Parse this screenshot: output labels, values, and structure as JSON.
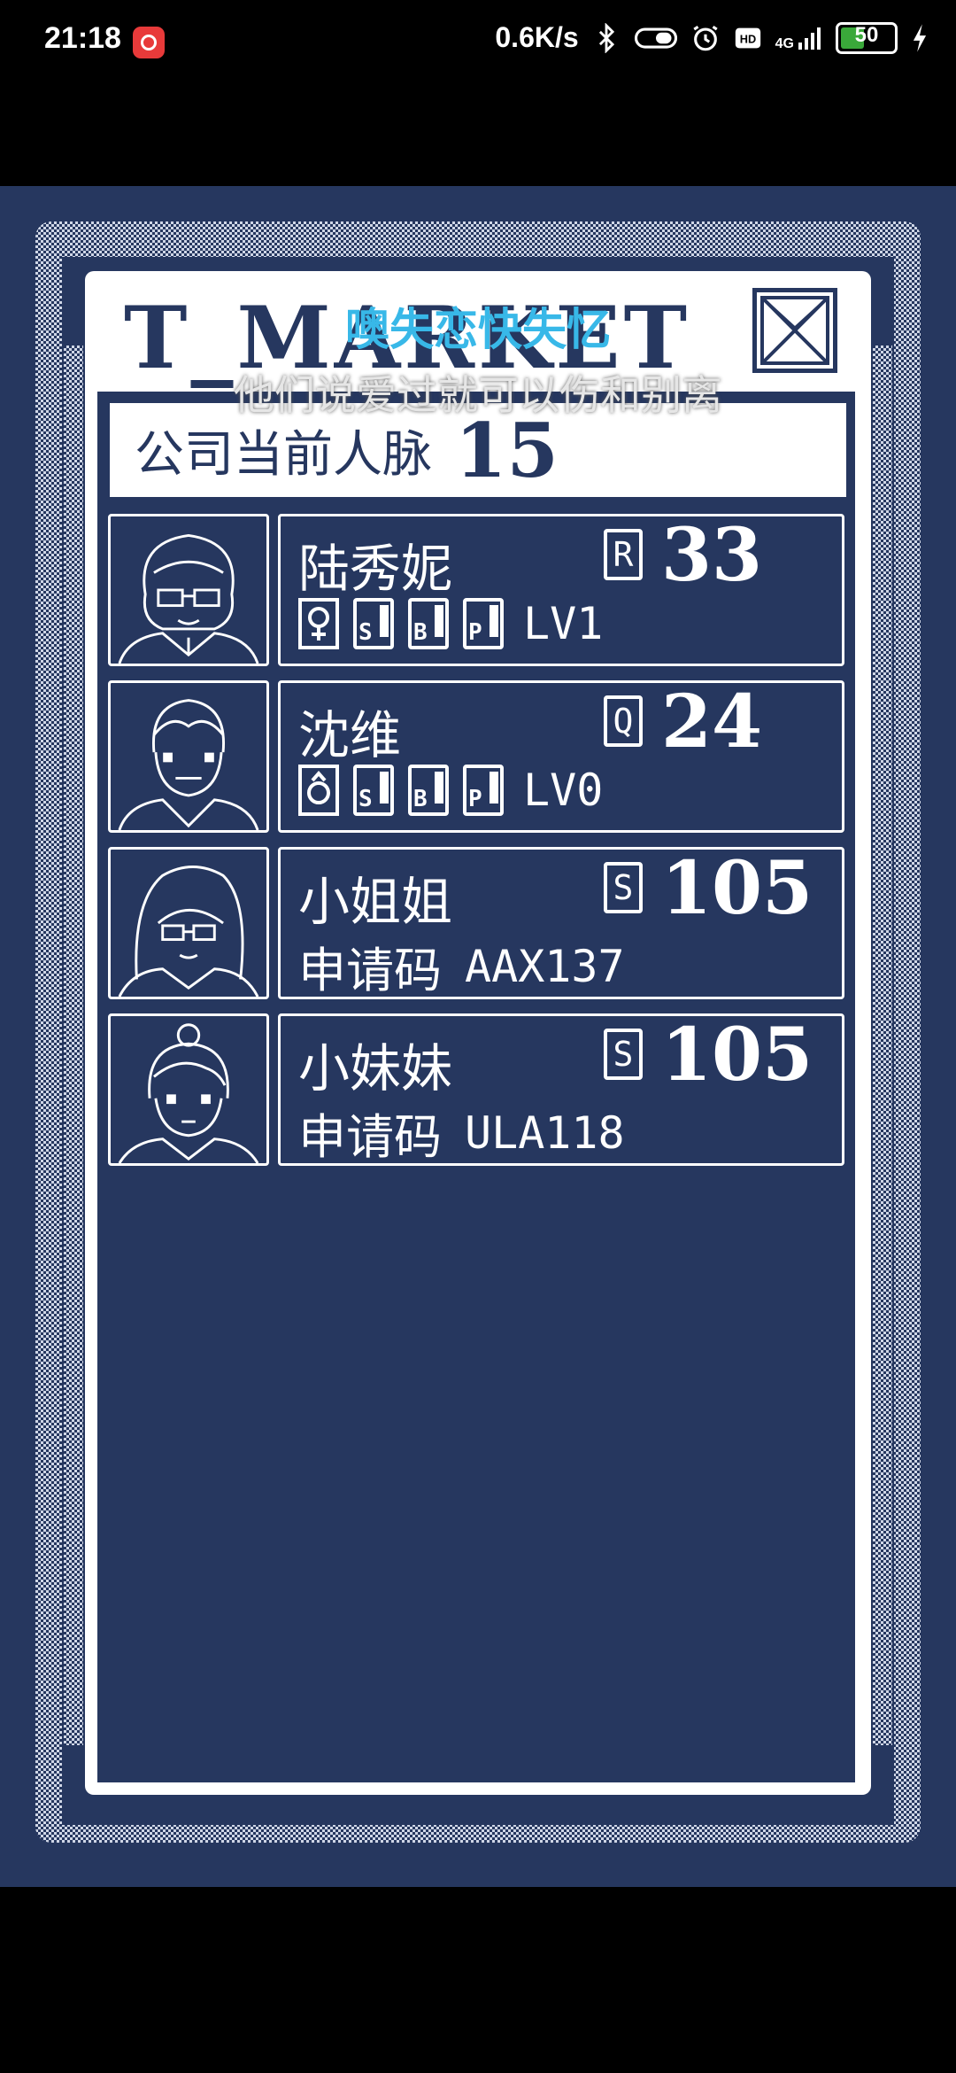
{
  "status_bar": {
    "time": "21:18",
    "net_speed": "0.6K/s",
    "signal_label": "4G",
    "battery": "50",
    "battery_level": 0.5
  },
  "game": {
    "title": "T_MARKET",
    "lyric_top": "噢失恋快失忆",
    "lyric_bottom": "他们说爱过就可以伤和别离",
    "summary": {
      "label": "公司当前人脉",
      "value": "15"
    },
    "contacts": [
      {
        "name": "陆秀妮",
        "rank": "R",
        "score": "33",
        "gender": "female",
        "stats": [
          "S",
          "B",
          "P"
        ],
        "level": "LV1"
      },
      {
        "name": "沈维",
        "rank": "Q",
        "score": "24",
        "gender": "male",
        "stats": [
          "S",
          "B",
          "P"
        ],
        "level": "LV0"
      },
      {
        "name": "小姐姐",
        "rank": "S",
        "score": "105",
        "code_label": "申请码",
        "code": "AAX137"
      },
      {
        "name": "小妹妹",
        "rank": "S",
        "score": "105",
        "code_label": "申请码",
        "code": "ULA118"
      }
    ]
  }
}
